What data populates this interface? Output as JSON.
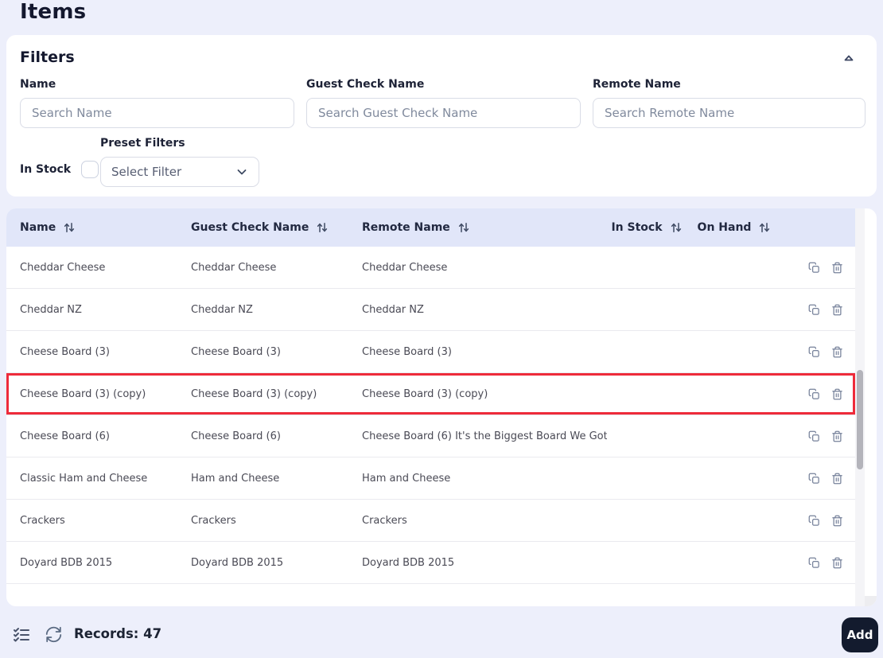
{
  "page": {
    "title": "Items"
  },
  "filters": {
    "heading": "Filters",
    "name_label": "Name",
    "name_placeholder": "Search Name",
    "guest_check_label": "Guest Check Name",
    "guest_check_placeholder": "Search Guest Check Name",
    "remote_label": "Remote Name",
    "remote_placeholder": "Search Remote Name",
    "in_stock_label": "In Stock",
    "in_stock_checked": false,
    "preset_label": "Preset Filters",
    "preset_selected_value": "Select Filter"
  },
  "table": {
    "columns": [
      {
        "label": "Name",
        "sortable": true
      },
      {
        "label": "Guest Check Name",
        "sortable": true
      },
      {
        "label": "Remote Name",
        "sortable": true
      },
      {
        "label": "In Stock",
        "sortable": true
      },
      {
        "label": "On Hand",
        "sortable": true
      }
    ],
    "rows": [
      {
        "name": "Cheddar Cheese",
        "guest_check_name": "Cheddar Cheese",
        "remote_name": "Cheddar Cheese",
        "in_stock": "",
        "on_hand": "",
        "highlighted": false
      },
      {
        "name": "Cheddar NZ",
        "guest_check_name": "Cheddar NZ",
        "remote_name": "Cheddar NZ",
        "in_stock": "",
        "on_hand": "",
        "highlighted": false
      },
      {
        "name": "Cheese Board (3)",
        "guest_check_name": "Cheese Board (3)",
        "remote_name": "Cheese Board (3)",
        "in_stock": "",
        "on_hand": "",
        "highlighted": false
      },
      {
        "name": "Cheese Board (3) (copy)",
        "guest_check_name": "Cheese Board (3) (copy)",
        "remote_name": "Cheese Board (3) (copy)",
        "in_stock": "",
        "on_hand": "",
        "highlighted": true
      },
      {
        "name": "Cheese Board (6)",
        "guest_check_name": "Cheese Board (6)",
        "remote_name": "Cheese Board (6) It's the Biggest Board We Got",
        "in_stock": "",
        "on_hand": "",
        "highlighted": false
      },
      {
        "name": "Classic Ham and Cheese",
        "guest_check_name": "Ham and Cheese",
        "remote_name": "Ham and Cheese",
        "in_stock": "",
        "on_hand": "",
        "highlighted": false
      },
      {
        "name": "Crackers",
        "guest_check_name": "Crackers",
        "remote_name": "Crackers",
        "in_stock": "",
        "on_hand": "",
        "highlighted": false
      },
      {
        "name": "Doyard BDB 2015",
        "guest_check_name": "Doyard BDB 2015",
        "remote_name": "Doyard BDB 2015",
        "in_stock": "",
        "on_hand": "",
        "highlighted": false
      }
    ]
  },
  "footer": {
    "records_text": "Records: 47",
    "add_label": "Add"
  },
  "icons": {
    "collapse": "caret-up-icon",
    "sort": "sort-arrows-icon",
    "row_copy": "copy-icon",
    "row_delete": "trash-icon",
    "footer_columns": "list-checks-icon",
    "footer_refresh": "refresh-icon",
    "select_chevron": "chevron-down-icon"
  },
  "colors": {
    "page_bg": "#edeffb",
    "card_bg": "#ffffff",
    "table_header_bg": "#e1e6f9",
    "highlight_border": "#ee2b3a",
    "add_button_bg": "#131b2e",
    "title_text": "#14182e"
  }
}
